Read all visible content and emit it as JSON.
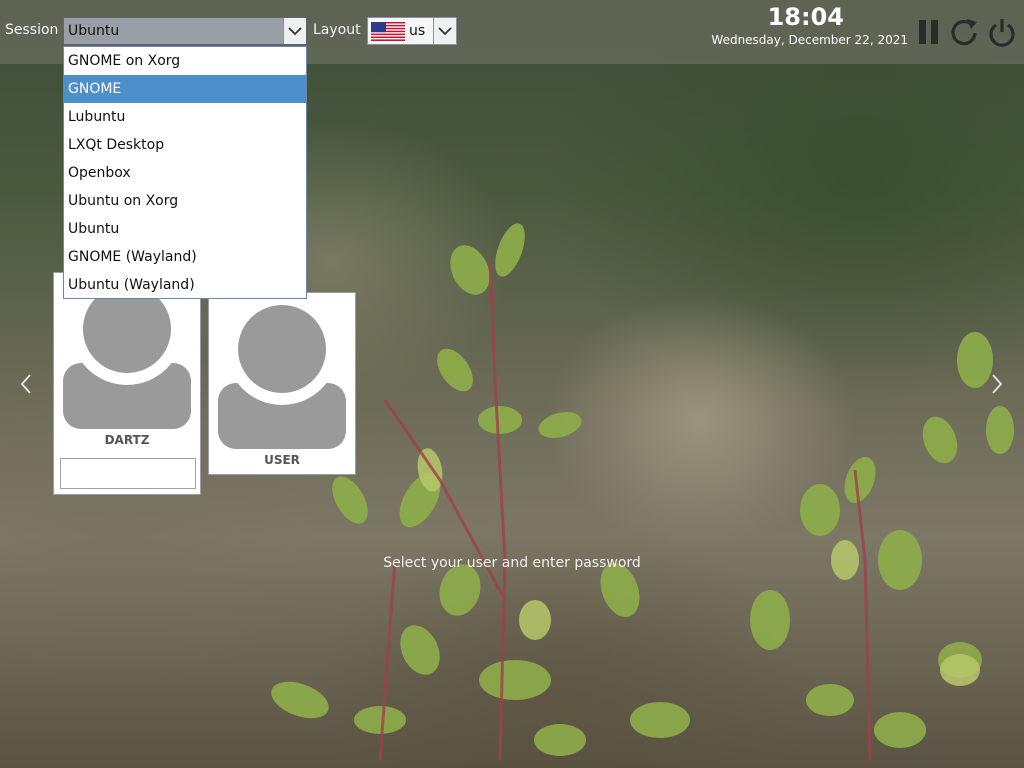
{
  "topbar": {
    "session_label": "Session",
    "session_value": "Ubuntu",
    "layout_label": "Layout",
    "layout_value": "us",
    "clock_time": "18:04",
    "clock_date": "Wednesday, December 22, 2021"
  },
  "session_dropdown": {
    "options": [
      "GNOME on Xorg",
      "GNOME",
      "Lubuntu",
      "LXQt Desktop",
      "Openbox",
      "Ubuntu on Xorg",
      "Ubuntu",
      "GNOME (Wayland)",
      "Ubuntu (Wayland)"
    ],
    "highlighted": "GNOME"
  },
  "users": [
    {
      "name": "DARTZ",
      "password": ""
    },
    {
      "name": "USER"
    }
  ],
  "hint_text": "Select your user and enter password",
  "icons": {
    "suspend": "pause-icon",
    "restart": "restart-icon",
    "shutdown": "power-icon",
    "prev": "chevron-left-icon",
    "next": "chevron-right-icon"
  },
  "colors": {
    "highlight": "#4d8fc8",
    "avatar": "#9a9a9a"
  }
}
